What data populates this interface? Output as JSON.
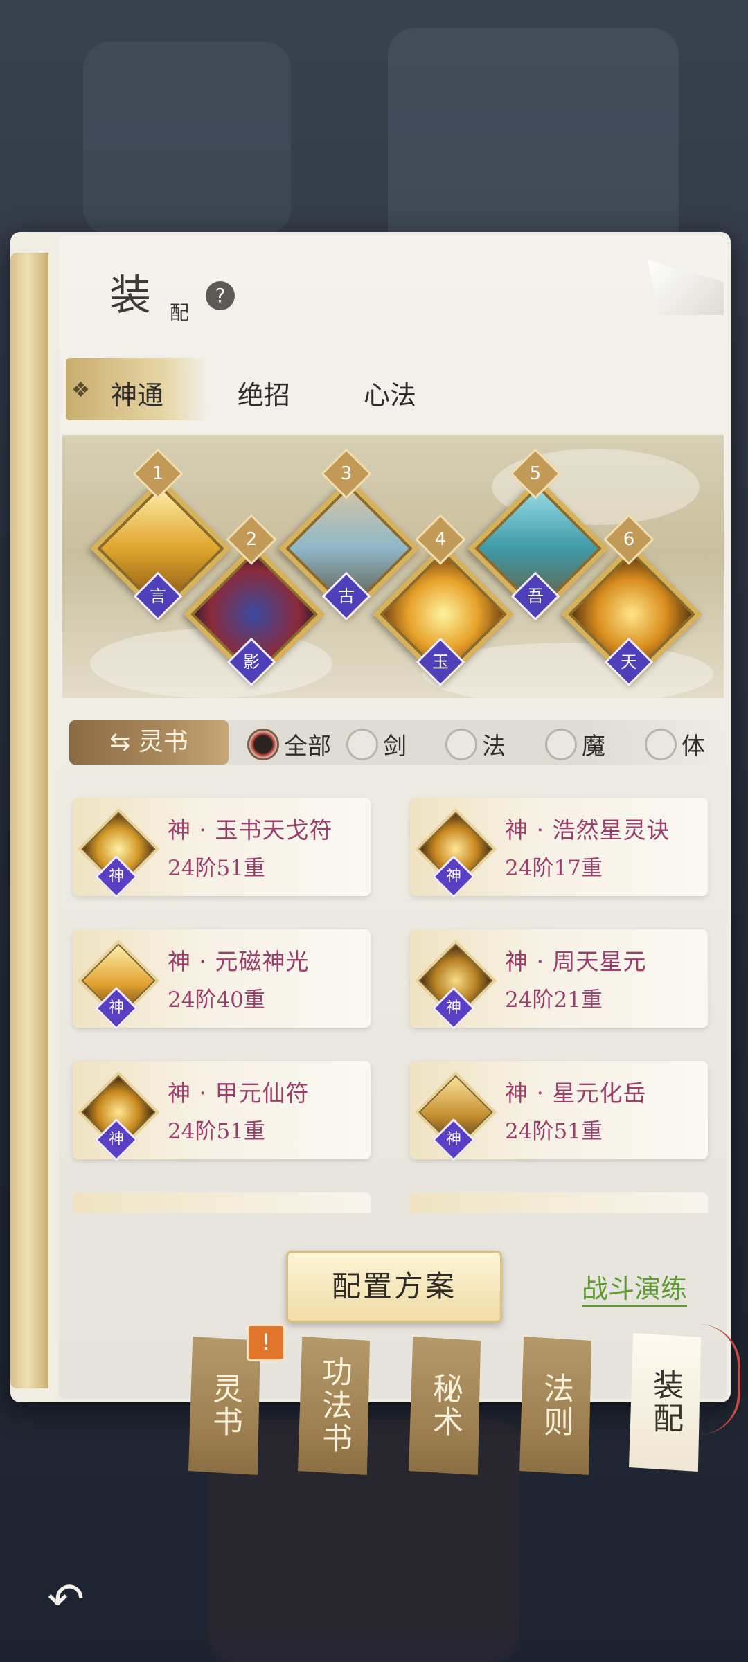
{
  "title": {
    "big": "装",
    "small": "配"
  },
  "tabs": [
    {
      "label": "神通",
      "active": true
    },
    {
      "label": "绝招",
      "active": false
    },
    {
      "label": "心法",
      "active": false
    }
  ],
  "slots": [
    {
      "num": "1",
      "badge": "言",
      "art": "golden-slash-icon"
    },
    {
      "num": "2",
      "badge": "影",
      "art": "dark-sword-icon"
    },
    {
      "num": "3",
      "badge": "古",
      "art": "wind-sword-icon"
    },
    {
      "num": "4",
      "badge": "玉",
      "art": "golden-flame-icon"
    },
    {
      "num": "5",
      "badge": "吾",
      "art": "water-dragon-icon"
    },
    {
      "num": "6",
      "badge": "天",
      "art": "golden-fish-icon"
    }
  ],
  "filter": {
    "tag_label": "灵书",
    "options": [
      {
        "label": "全部",
        "selected": true
      },
      {
        "label": "剑",
        "selected": false
      },
      {
        "label": "法",
        "selected": false
      },
      {
        "label": "魔",
        "selected": false
      },
      {
        "label": "体",
        "selected": false
      }
    ]
  },
  "cards": [
    {
      "name": "神 · 玉书天戈符",
      "level": "24阶51重",
      "badge": "神"
    },
    {
      "name": "神 · 浩然星灵诀",
      "level": "24阶17重",
      "badge": "神"
    },
    {
      "name": "神 · 元磁神光",
      "level": "24阶40重",
      "badge": "神"
    },
    {
      "name": "神 · 周天星元",
      "level": "24阶21重",
      "badge": "神"
    },
    {
      "name": "神 · 甲元仙符",
      "level": "24阶51重",
      "badge": "神"
    },
    {
      "name": "神 · 星元化岳",
      "level": "24阶51重",
      "badge": "神"
    }
  ],
  "bottom": {
    "plan_button": "配置方案",
    "battle_link": "战斗演练"
  },
  "side_tabs": [
    {
      "label": "灵书",
      "alert": "!"
    },
    {
      "label": "功法书"
    },
    {
      "label": "秘术"
    },
    {
      "label": "法则"
    },
    {
      "label": "装配",
      "active": true
    }
  ],
  "colors": {
    "accent_gold": "#d8b25a",
    "rank_badge": "#5a3fc4",
    "card_text": "#9a3f6a",
    "battle_link": "#5f9a35",
    "alert": "#e0752c"
  }
}
